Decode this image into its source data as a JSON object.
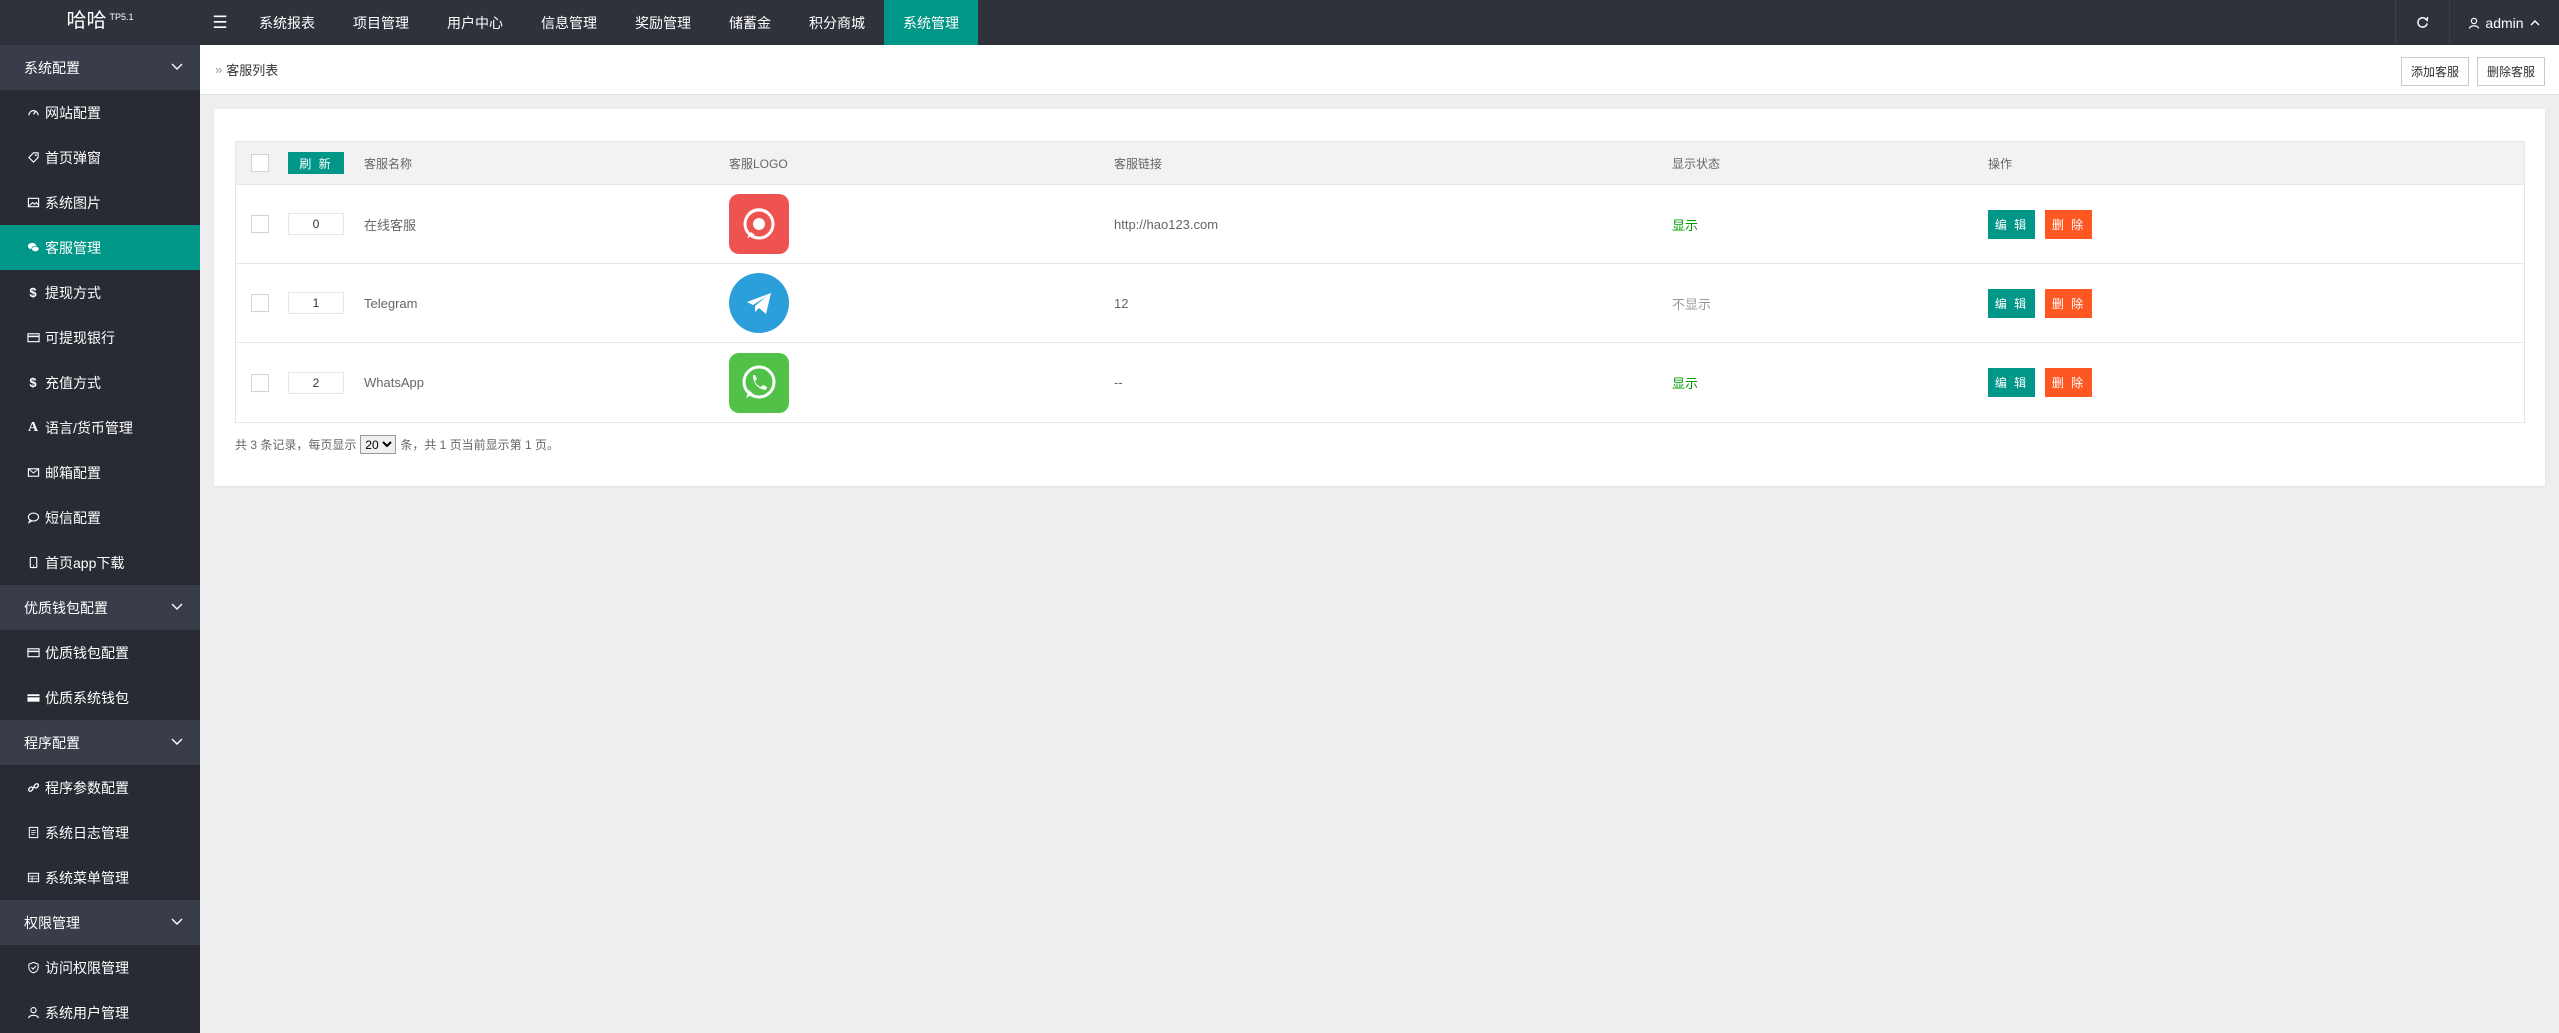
{
  "app": {
    "title": "哈哈",
    "version": "TP5.1"
  },
  "topnav": {
    "items": [
      "系统报表",
      "项目管理",
      "用户中心",
      "信息管理",
      "奖励管理",
      "储蓄金",
      "积分商城",
      "系统管理"
    ],
    "active_index": 7,
    "user": "admin"
  },
  "sidebar": {
    "group1": {
      "label": "系统配置"
    },
    "items1": [
      {
        "label": "网站配置",
        "icon": "dashboard-icon"
      },
      {
        "label": "首页弹窗",
        "icon": "tag-icon"
      },
      {
        "label": "系统图片",
        "icon": "image-icon"
      },
      {
        "label": "客服管理",
        "icon": "chat-icon"
      },
      {
        "label": "提现方式",
        "icon": "dollar-icon"
      },
      {
        "label": "可提现银行",
        "icon": "card-icon"
      },
      {
        "label": "充值方式",
        "icon": "dollar-icon"
      },
      {
        "label": "语言/货币管理",
        "icon": "font-icon"
      },
      {
        "label": "邮箱配置",
        "icon": "mail-icon"
      },
      {
        "label": "短信配置",
        "icon": "comment-icon"
      },
      {
        "label": "首页app下载",
        "icon": "mobile-icon"
      }
    ],
    "group2": {
      "label": "优质钱包配置"
    },
    "items2": [
      {
        "label": "优质钱包配置",
        "icon": "card-icon"
      },
      {
        "label": "优质系统钱包",
        "icon": "wallet-icon"
      }
    ],
    "group3": {
      "label": "程序配置"
    },
    "items3": [
      {
        "label": "程序参数配置",
        "icon": "link-icon"
      },
      {
        "label": "系统日志管理",
        "icon": "file-icon"
      },
      {
        "label": "系统菜单管理",
        "icon": "table-icon"
      }
    ],
    "group4": {
      "label": "权限管理"
    },
    "items4": [
      {
        "label": "访问权限管理",
        "icon": "shield-icon"
      },
      {
        "label": "系统用户管理",
        "icon": "user-icon"
      }
    ]
  },
  "breadcrumb": {
    "title": "客服列表"
  },
  "actions": {
    "add": "添加客服",
    "delete": "删除客服"
  },
  "table": {
    "refresh": "刷 新",
    "headers": {
      "name": "客服名称",
      "logo": "客服LOGO",
      "link": "客服链接",
      "status": "显示状态",
      "ops": "操作"
    },
    "rows": [
      {
        "sort": "0",
        "name": "在线客服",
        "logo": "support-logo-icon",
        "link": "http://hao123.com",
        "status": "显示",
        "shown": true
      },
      {
        "sort": "1",
        "name": "Telegram",
        "logo": "telegram-logo-icon",
        "link": "12",
        "status": "不显示",
        "shown": false
      },
      {
        "sort": "2",
        "name": "WhatsApp",
        "logo": "whatsapp-logo-icon",
        "link": "--",
        "status": "显示",
        "shown": true
      }
    ],
    "edit_label": "编 辑",
    "delete_label": "删 除"
  },
  "pager": {
    "prefix": "共 3 条记录，每页显示",
    "page_size": "20",
    "suffix": "条，共 1 页当前显示第 1 页。"
  },
  "colors": {
    "accent": "#009688",
    "danger": "#ff5722",
    "sidebar": "#282b33",
    "topbar": "#2f323b"
  }
}
